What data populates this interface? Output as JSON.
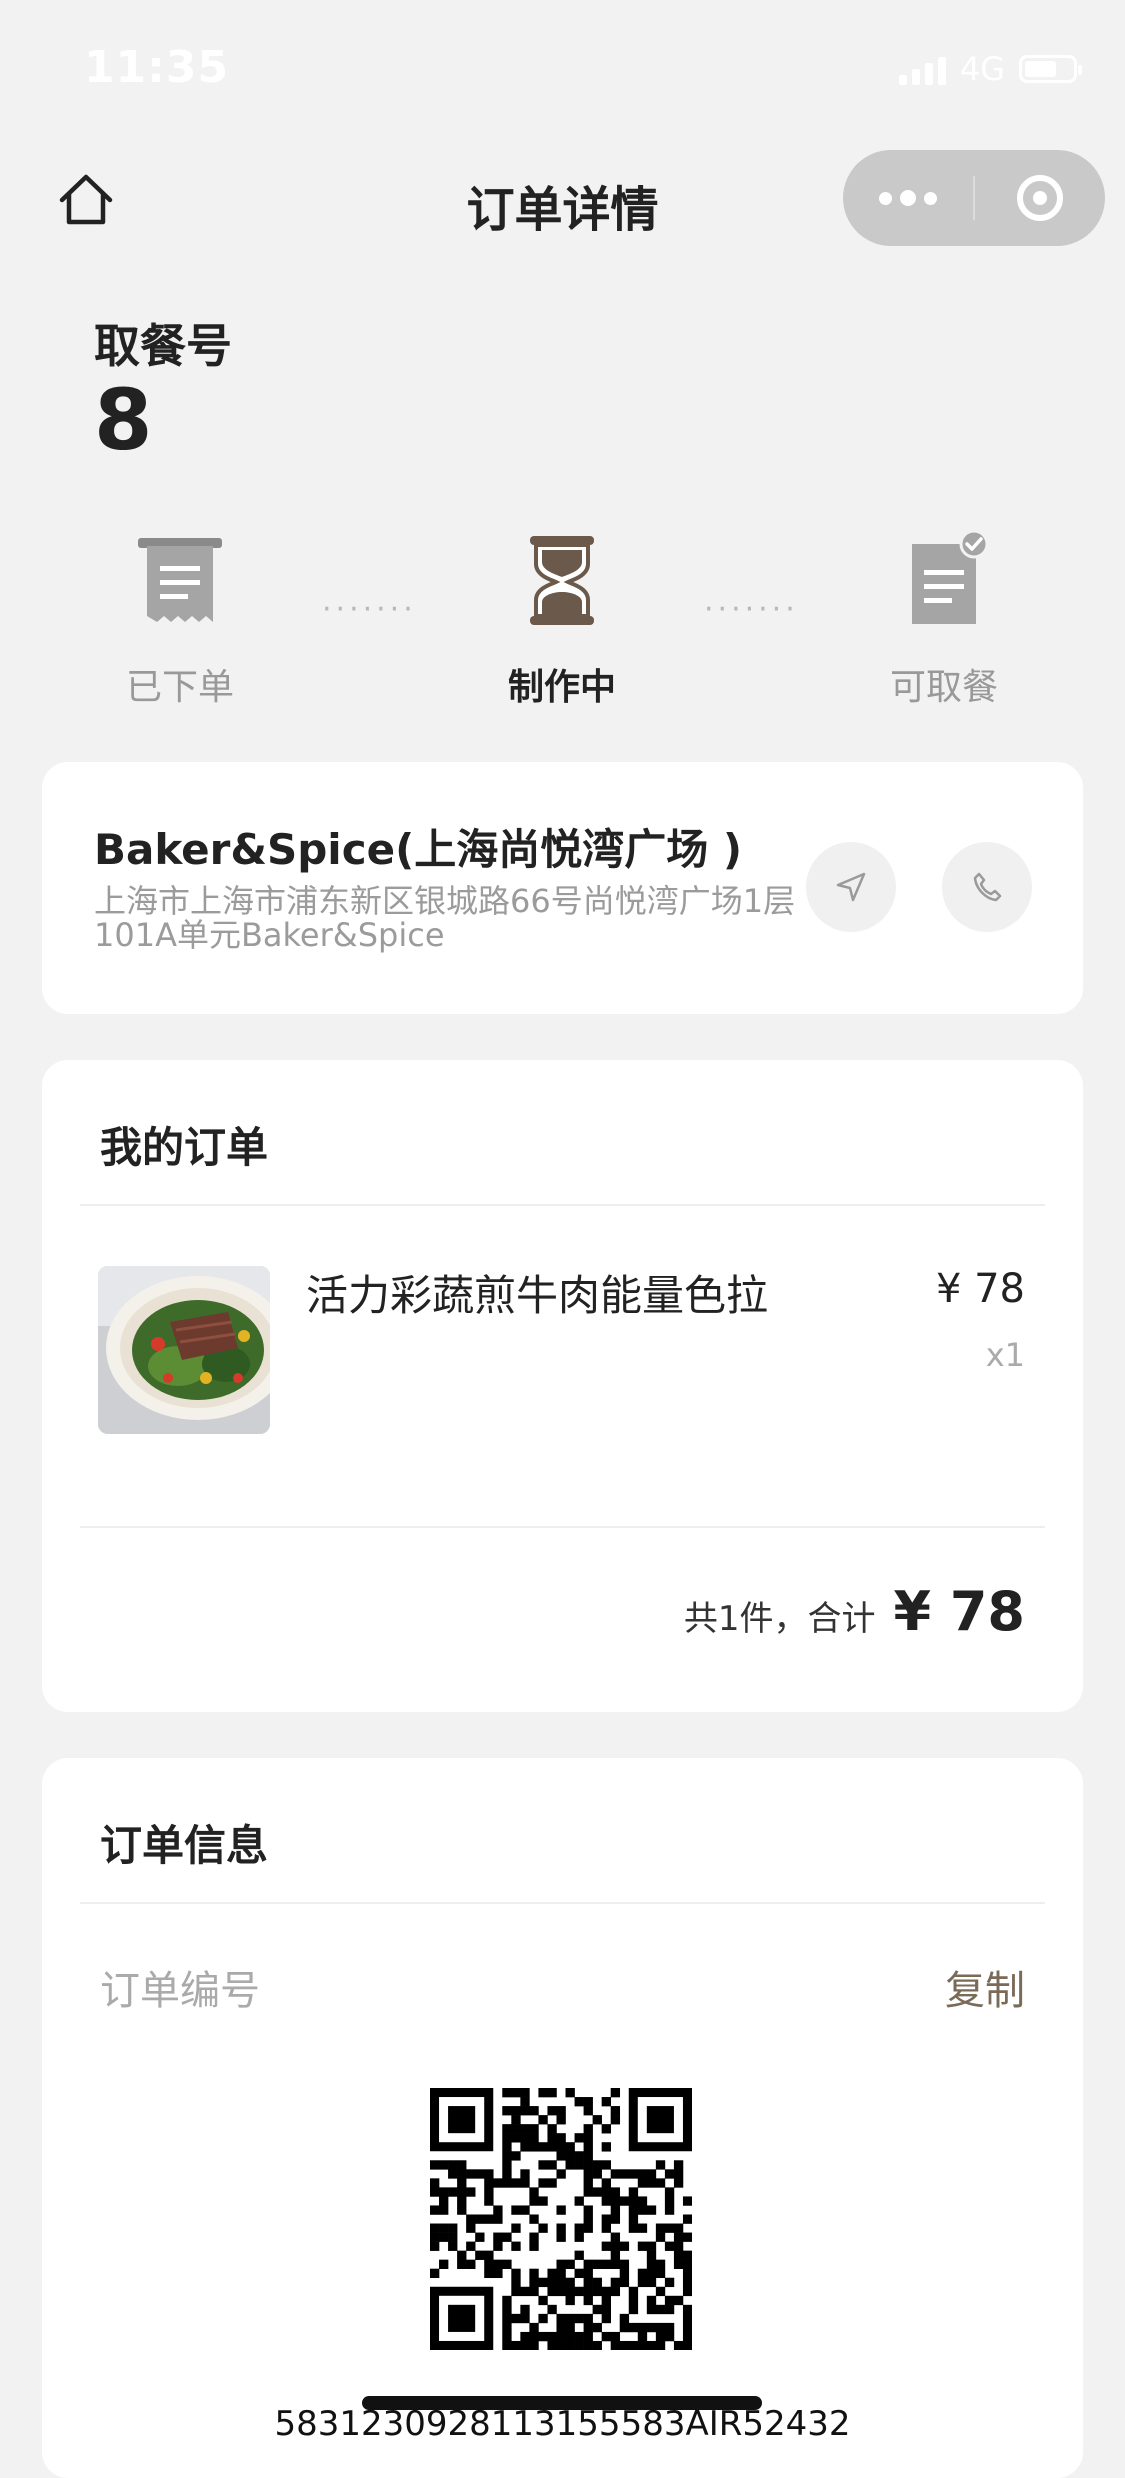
{
  "status_bar": {
    "time": "11:35",
    "network": "4G"
  },
  "nav": {
    "title": "订单详情"
  },
  "pickup": {
    "label": "取餐号",
    "number": "8"
  },
  "progress": {
    "steps": [
      {
        "label": "已下单",
        "icon": "receipt-icon",
        "state": "done"
      },
      {
        "label": "制作中",
        "icon": "hourglass-icon",
        "state": "active"
      },
      {
        "label": "可取餐",
        "icon": "checked-document-icon",
        "state": "pending"
      }
    ],
    "connector": "·······"
  },
  "store": {
    "name": "Baker&Spice(上海尚悦湾广场 )",
    "address": "上海市上海市浦东新区银城路66号尚悦湾广场1层101A单元Baker&Spice"
  },
  "order": {
    "title": "我的订单",
    "items": [
      {
        "name": "活力彩蔬煎牛肉能量色拉",
        "price": "¥ 78",
        "qty": "x1"
      }
    ],
    "total_label": "共1件，合计",
    "total_amount": "¥ 78"
  },
  "info": {
    "title": "订单信息",
    "order_no_label": "订单编号",
    "copy_label": "复制",
    "order_no": "5831230928113155583AIR52432"
  },
  "colors": {
    "accent": "#7a6a58",
    "background": "#f2f2f2",
    "card": "#ffffff",
    "muted": "#9b9b9b"
  }
}
